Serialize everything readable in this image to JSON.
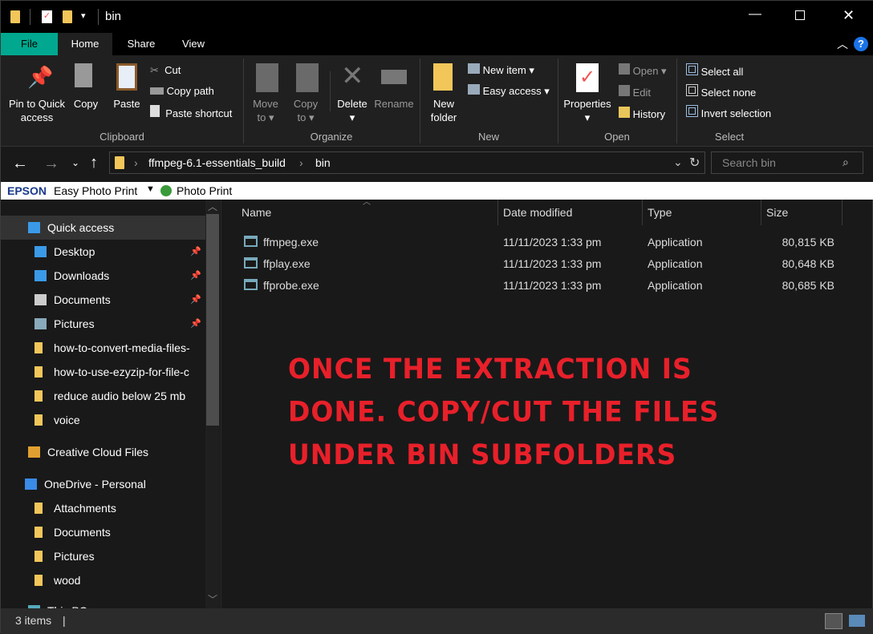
{
  "window": {
    "title": "bin"
  },
  "tabs": [
    "File",
    "Home",
    "Share",
    "View"
  ],
  "ribbon": {
    "clipboard": {
      "group": "Clipboard",
      "pin": "Pin to Quick access",
      "pin1": "Pin to Quick",
      "pin2": "access",
      "copy": "Copy",
      "paste": "Paste",
      "cut": "Cut",
      "copy_path": "Copy path",
      "paste_shortcut": "Paste shortcut"
    },
    "organize": {
      "group": "Organize",
      "move1": "Move",
      "move2": "to",
      "copy1": "Copy",
      "copy2": "to",
      "delete": "Delete",
      "rename": "Rename"
    },
    "new": {
      "group": "New",
      "new_folder1": "New",
      "new_folder2": "folder",
      "new_item": "New item",
      "easy_access": "Easy access"
    },
    "open": {
      "group": "Open",
      "properties": "Properties",
      "open": "Open",
      "edit": "Edit",
      "history": "History"
    },
    "select": {
      "group": "Select",
      "select_all": "Select all",
      "select_none": "Select none",
      "invert": "Invert selection"
    }
  },
  "address": {
    "crumbs": [
      "ffmpeg-6.1-essentials_build",
      "bin"
    ],
    "search_placeholder": "Search bin"
  },
  "epson": {
    "brand": "EPSON",
    "easy_photo_print": "Easy Photo Print",
    "photo_print": "Photo Print"
  },
  "sidebar": {
    "items": [
      {
        "label": "Quick access",
        "icon": "star-icon"
      },
      {
        "label": "Desktop",
        "icon": "desktop-icon",
        "pinned": true
      },
      {
        "label": "Downloads",
        "icon": "download-icon",
        "pinned": true
      },
      {
        "label": "Documents",
        "icon": "documents-icon",
        "pinned": true
      },
      {
        "label": "Pictures",
        "icon": "pictures-icon",
        "pinned": true
      },
      {
        "label": "how-to-convert-media-files-",
        "icon": "folder-icon"
      },
      {
        "label": "how-to-use-ezyzip-for-file-c",
        "icon": "folder-icon"
      },
      {
        "label": "reduce audio below 25 mb",
        "icon": "folder-icon"
      },
      {
        "label": "voice",
        "icon": "folder-icon"
      },
      {
        "label": "Creative Cloud Files",
        "icon": "creative-cloud-icon"
      },
      {
        "label": "OneDrive - Personal",
        "icon": "cloud-icon"
      },
      {
        "label": "Attachments",
        "icon": "folder-icon"
      },
      {
        "label": "Documents",
        "icon": "folder-icon"
      },
      {
        "label": "Pictures",
        "icon": "folder-icon"
      },
      {
        "label": "wood",
        "icon": "folder-icon"
      },
      {
        "label": "This PC",
        "icon": "computer-icon"
      }
    ]
  },
  "columns": [
    "Name",
    "Date modified",
    "Type",
    "Size"
  ],
  "files": [
    {
      "name": "ffmpeg.exe",
      "date": "11/11/2023 1:33 pm",
      "type": "Application",
      "size": "80,815 KB"
    },
    {
      "name": "ffplay.exe",
      "date": "11/11/2023 1:33 pm",
      "type": "Application",
      "size": "80,648 KB"
    },
    {
      "name": "ffprobe.exe",
      "date": "11/11/2023 1:33 pm",
      "type": "Application",
      "size": "80,685 KB"
    }
  ],
  "overlay": [
    "ONCE THE EXTRACTION IS",
    "DONE. COPY/CUT THE FILES",
    "UNDER BIN SUBFOLDERS"
  ],
  "status": {
    "count": "3 items"
  },
  "colors": {
    "file_tab": "#00a88f",
    "overlay_text": "#e8202a"
  }
}
